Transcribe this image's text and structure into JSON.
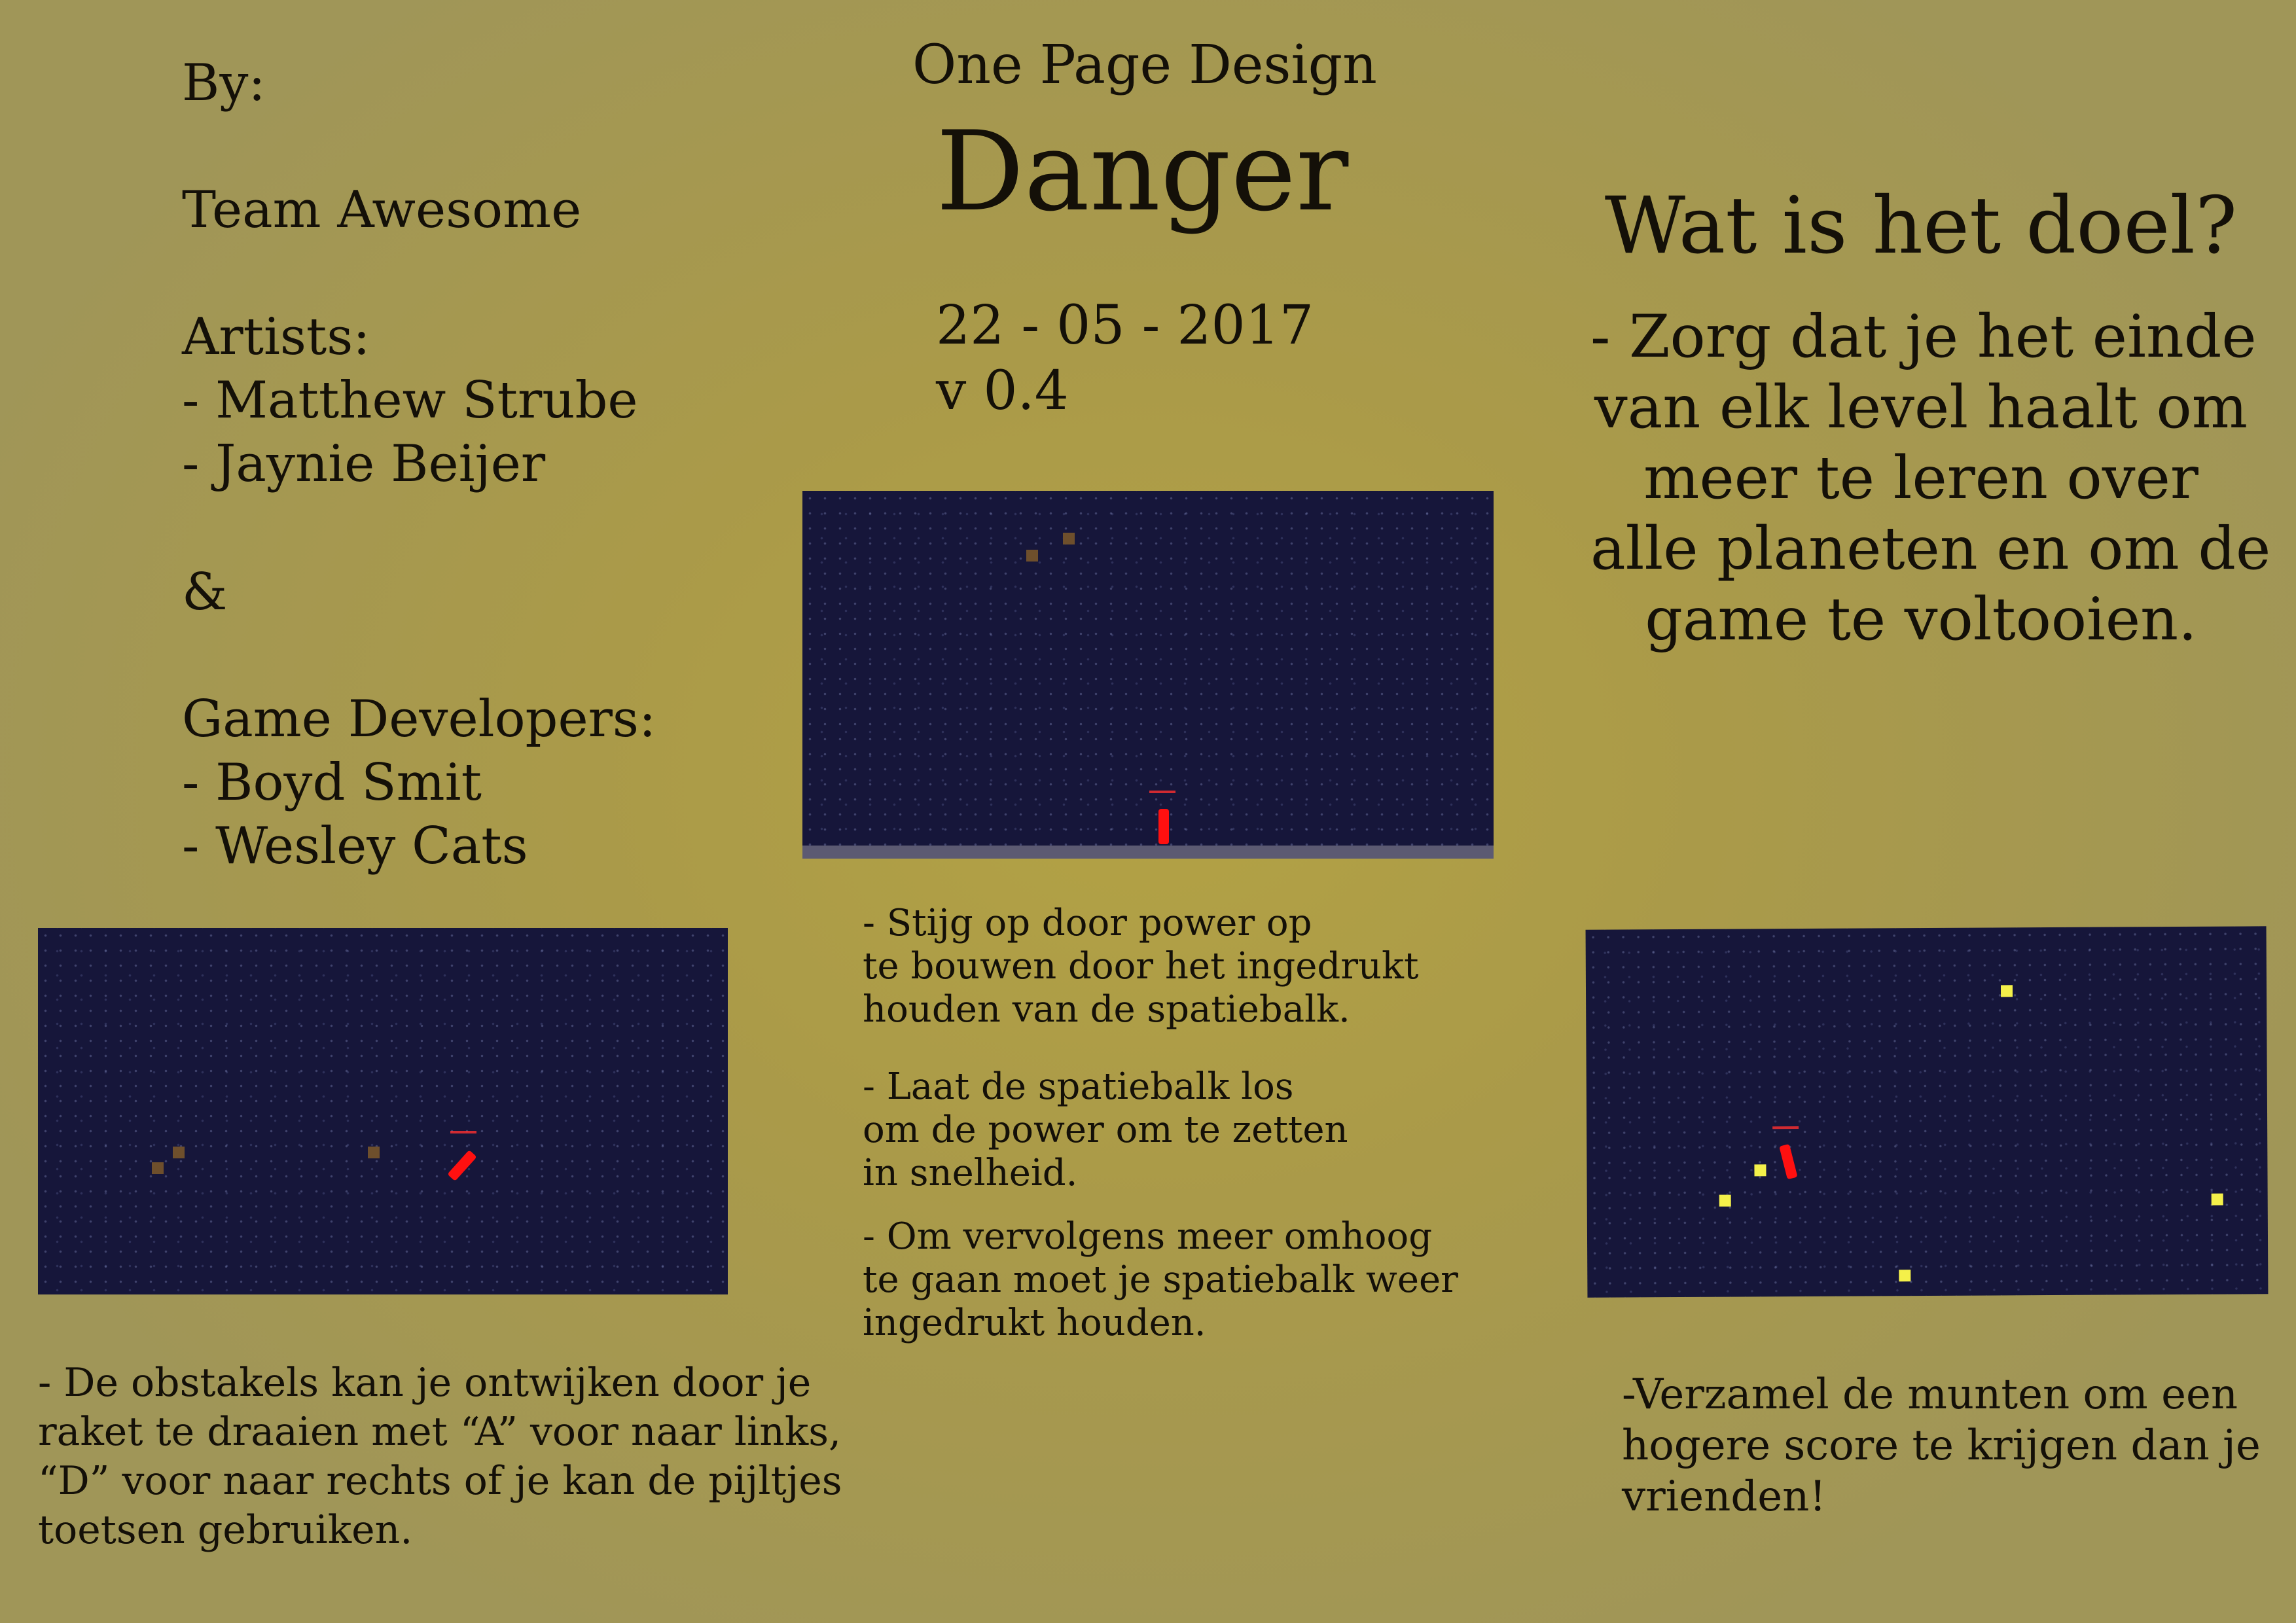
{
  "credits": {
    "by_label": "By:",
    "team": "Team Awesome",
    "artists_label": "Artists:",
    "artists": [
      "- Matthew Strube",
      "- Jaynie Beijer"
    ],
    "ampersand": "&",
    "devs_label": "Game Developers:",
    "devs": [
      "- Boyd Smit",
      "- Wesley Cats"
    ]
  },
  "header": {
    "subtitle": "One Page Design",
    "title": "Danger",
    "date": "22 - 05 - 2017",
    "version": "v 0.4"
  },
  "goal": {
    "heading": "Wat is het doel?",
    "lines": [
      "- Zorg dat je het einde",
      "van elk level haalt om",
      "meer te leren over",
      "alle planeten en om de",
      "game te voltooien."
    ]
  },
  "instructions_center": [
    [
      "- Stijg op door power op",
      "te bouwen door het ingedrukt",
      "houden van de spatiebalk."
    ],
    [
      "- Laat de spatiebalk los",
      "om de power om te zetten",
      "in snelheid."
    ],
    [
      "- Om vervolgens meer omhoog",
      "te gaan moet je spatiebalk weer",
      "ingedrukt houden."
    ]
  ],
  "instructions_left": [
    "- De obstakels kan je ontwijken door je",
    "raket te draaien met “A” voor naar links,",
    "“D” voor naar rechts of je kan de pijltjes",
    "toetsen gebruiken."
  ],
  "instructions_right": [
    "-Verzamel de munten om een",
    "hogere score te krijgen dan je",
    "vrienden!"
  ],
  "colors": {
    "space": "#16163a",
    "rocket": "#ff1010",
    "obstacle": "#6e4f2c",
    "coin": "#f4f04a",
    "ground": "#5c5a72"
  }
}
